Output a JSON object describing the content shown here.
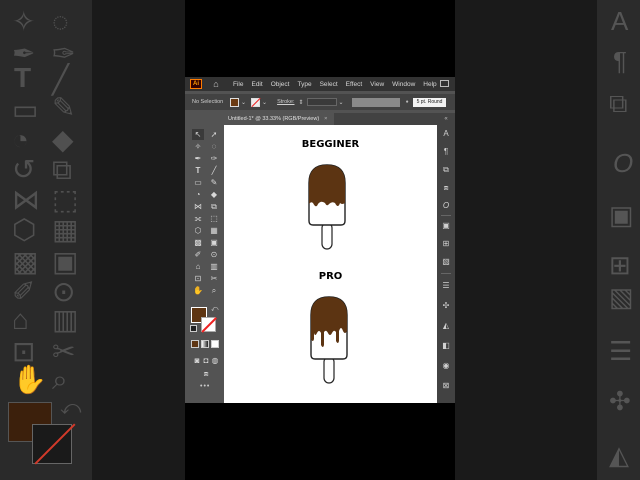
{
  "app": {
    "logo": "Ai",
    "menu": [
      "File",
      "Edit",
      "Object",
      "Type",
      "Select",
      "Effect",
      "View",
      "Window",
      "Help"
    ]
  },
  "control_bar": {
    "selection": "No Selection",
    "stroke_label": "Stroke:",
    "brush_profile": "5 pt. Round",
    "fill_color": "#6b3a12"
  },
  "document": {
    "tab_title": "Untitled-1* @ 33.33% (RGB/Preview)",
    "close": "×"
  },
  "artboard": {
    "label_beginner": "BEGGINER",
    "label_pro": "PRO",
    "chocolate_color": "#5c3412"
  },
  "icons": {
    "home": "home-icon",
    "selection": "selection-tool-icon",
    "direct_selection": "direct-selection-icon",
    "pen": "pen-icon",
    "type": "type-icon",
    "hand": "hand-icon",
    "zoom": "zoom-icon"
  }
}
